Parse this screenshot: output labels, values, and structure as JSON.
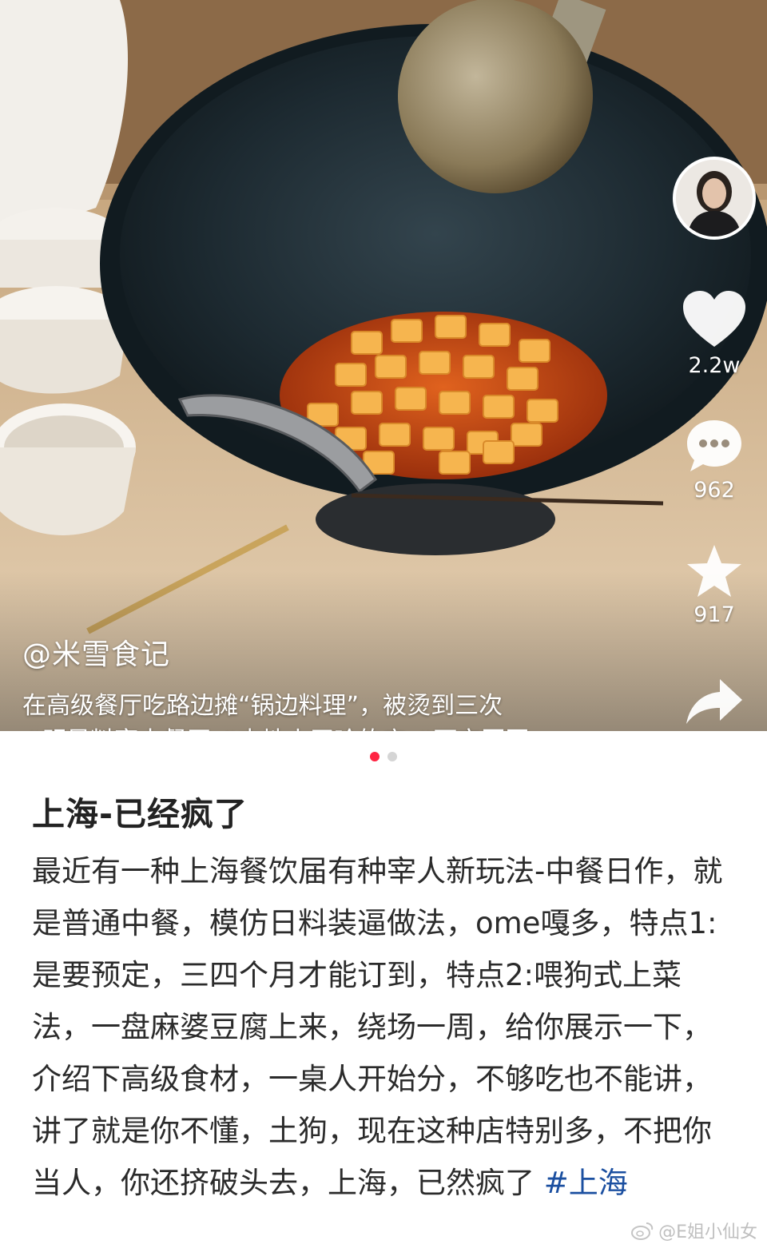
{
  "video": {
    "author_handle": "@米雪食记",
    "caption": "在高级餐厅吃路边摊“锅边料理”，被烫到三次",
    "tags_line": "#明星料亭中餐厅 #吉地小买哈的店 #西安回国",
    "likes": "2.2w",
    "comments": "962",
    "favorites": "917"
  },
  "pager": {
    "total": 2,
    "active": 1
  },
  "post": {
    "title": "上海-已经疯了",
    "body": "最近有一种上海餐饮届有种宰人新玩法-中餐日作，就是普通中餐，模仿日料装逼做法，ome嘎多，特点1:是要预定，三四个月才能订到，特点2:喂狗式上菜法，一盘麻婆豆腐上来，绕场一周，给你展示一下，介绍下高级食材，一桌人开始分，不够吃也不能讲，讲了就是你不懂，土狗，现在这种店特别多，不把你当人，你还挤破头去，上海，已然疯了 ",
    "hashtag": "#上海"
  },
  "watermark": "@E姐小仙女",
  "icons": {
    "like": "heart-icon",
    "comment": "comment-bubble-icon",
    "favorite": "star-icon",
    "share": "share-arrow-icon",
    "watermark": "weibo-logo-icon"
  },
  "colors": {
    "accent": "#ff2442",
    "hashtag": "#1b4fa0"
  }
}
